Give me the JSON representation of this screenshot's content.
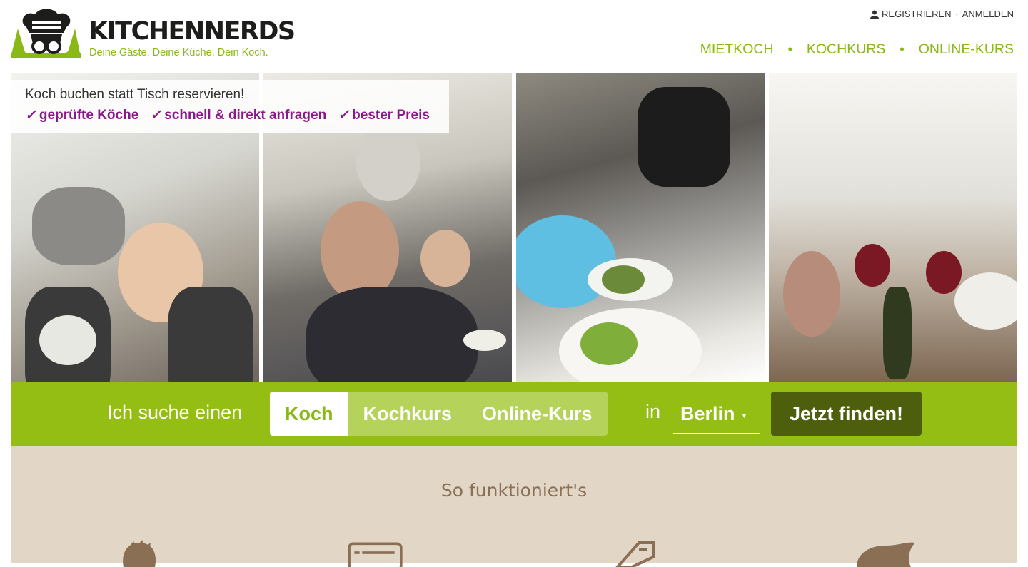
{
  "brand": {
    "name": "KITCHENNERDS",
    "tagline": "Deine Gäste. Deine Küche. Dein Koch.",
    "green": "#8ab816",
    "dark_green": "#4d5f0c"
  },
  "account": {
    "register": "REGISTRIEREN",
    "separator": "◦",
    "login": "ANMELDEN",
    "icon": "user-icon"
  },
  "nav": {
    "items": [
      {
        "label": "MIETKOCH"
      },
      {
        "label": "KOCHKURS"
      },
      {
        "label": "ONLINE-KURS"
      }
    ],
    "separator": "•"
  },
  "hero": {
    "title": "Koch buchen statt Tisch reservieren!",
    "features": [
      "geprüfte Köche",
      "schnell & direkt anfragen",
      "bester Preis"
    ],
    "feature_color": "#8a1a8a"
  },
  "search": {
    "prefix": "Ich suche einen",
    "options": [
      {
        "label": "Koch",
        "active": true
      },
      {
        "label": "Kochkurs",
        "active": false
      },
      {
        "label": "Online-Kurs",
        "active": false
      }
    ],
    "in_label": "in",
    "city": "Berlin",
    "button": "Jetzt finden!"
  },
  "how": {
    "title": "So funktioniert's",
    "icons": [
      "chef-head-icon",
      "card-icon",
      "voucher-icon",
      "dish-icon"
    ]
  }
}
